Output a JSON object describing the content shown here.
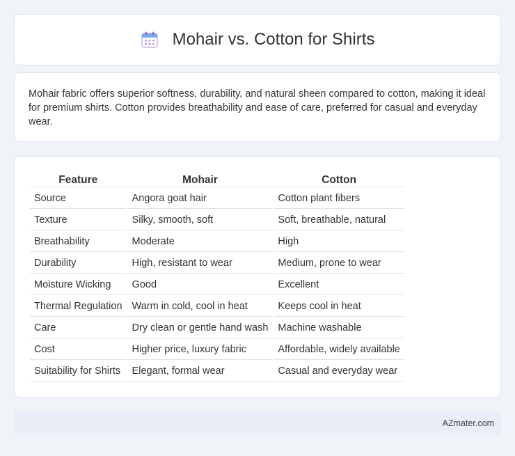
{
  "header": {
    "title": "Mohair vs. Cotton for Shirts",
    "icon": "calendar-icon"
  },
  "description": "Mohair fabric offers superior softness, durability, and natural sheen compared to cotton, making it ideal for premium shirts. Cotton provides breathability and ease of care, preferred for casual and everyday wear.",
  "table": {
    "headers": [
      "Feature",
      "Mohair",
      "Cotton"
    ],
    "rows": [
      [
        "Source",
        "Angora goat hair",
        "Cotton plant fibers"
      ],
      [
        "Texture",
        "Silky, smooth, soft",
        "Soft, breathable, natural"
      ],
      [
        "Breathability",
        "Moderate",
        "High"
      ],
      [
        "Durability",
        "High, resistant to wear",
        "Medium, prone to wear"
      ],
      [
        "Moisture Wicking",
        "Good",
        "Excellent"
      ],
      [
        "Thermal Regulation",
        "Warm in cold, cool in heat",
        "Keeps cool in heat"
      ],
      [
        "Care",
        "Dry clean or gentle hand wash",
        "Machine washable"
      ],
      [
        "Cost",
        "Higher price, luxury fabric",
        "Affordable, widely available"
      ],
      [
        "Suitability for Shirts",
        "Elegant, formal wear",
        "Casual and everyday wear"
      ]
    ]
  },
  "footer": {
    "brand": "AZmater.com"
  },
  "colors": {
    "background": "#f0f3f8",
    "card": "#ffffff",
    "border": "#dde3ec",
    "footer_bg": "#e8edf7",
    "icon_accent": "#5b8def"
  }
}
